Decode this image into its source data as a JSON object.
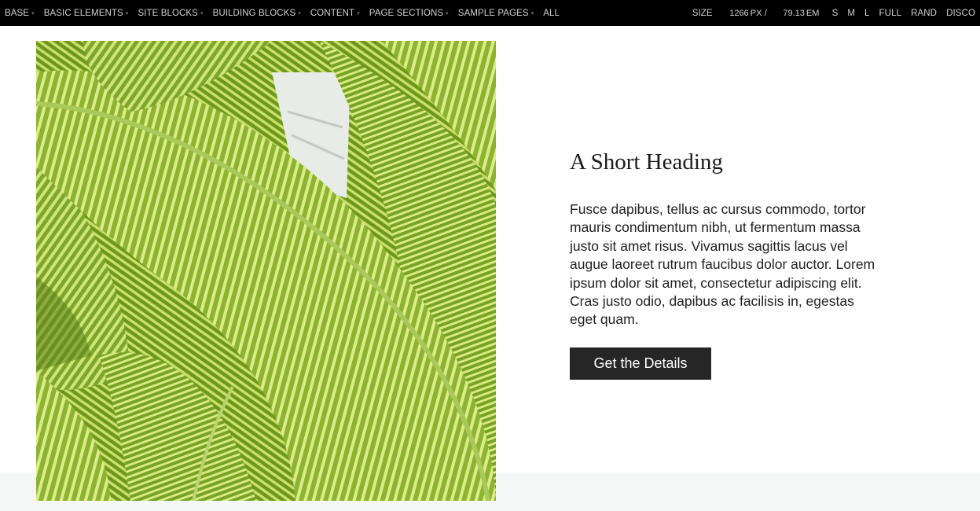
{
  "nav": {
    "items": [
      {
        "label": "BASE",
        "has_menu": true
      },
      {
        "label": "BASIC ELEMENTS",
        "has_menu": true
      },
      {
        "label": "SITE BLOCKS",
        "has_menu": true
      },
      {
        "label": "BUILDING BLOCKS",
        "has_menu": true
      },
      {
        "label": "CONTENT",
        "has_menu": true
      },
      {
        "label": "PAGE SECTIONS",
        "has_menu": true
      },
      {
        "label": "SAMPLE PAGES",
        "has_menu": true
      },
      {
        "label": "ALL",
        "has_menu": false
      }
    ],
    "caret_glyph": "▾",
    "size": {
      "label": "SIZE",
      "px_value": "1266",
      "px_unit": "PX /",
      "em_value": "79.13",
      "em_unit": "EM"
    },
    "size_buttons": [
      "S",
      "M",
      "L",
      "FULL",
      "RAND",
      "DISCO"
    ]
  },
  "media_block": {
    "image_subject": "striped green leaves",
    "heading": "A Short Heading",
    "body": "Fusce dapibus, tellus ac cursus commodo, tortor mauris condimentum nibh, ut fermentum massa justo sit amet risus. Vivamus sagittis lacus vel augue laoreet rutrum faucibus dolor auctor. Lorem ipsum dolor sit amet, consectetur adipiscing elit. Cras justo odio, dapibus ac facilisis in, egestas eget quam.",
    "button_label": "Get the Details"
  },
  "colors": {
    "topbar_bg": "#000000",
    "topbar_text": "#cfcfcf",
    "button_bg": "#262626",
    "leaf_dark": "#6f9a1e",
    "leaf_light": "#d4e878"
  }
}
